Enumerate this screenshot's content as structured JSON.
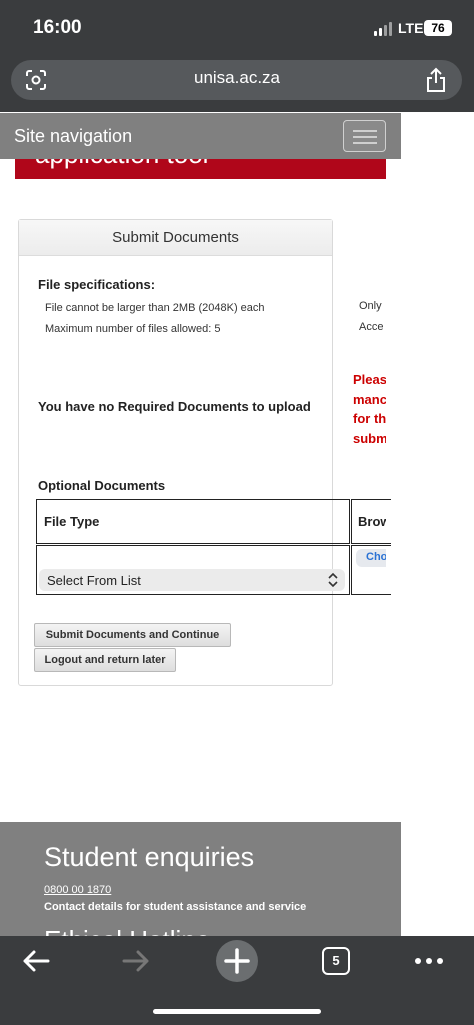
{
  "status_bar": {
    "time": "16:00",
    "network": "LTE",
    "battery": "76"
  },
  "browser": {
    "url": "unisa.ac.za",
    "tab_count": "5"
  },
  "site_nav": {
    "label": "Site navigation"
  },
  "banner": {
    "text": "application tool"
  },
  "panel": {
    "title": "Submit Documents",
    "specs_title": "File specifications:",
    "spec_size": "File cannot be larger than 2MB (2048K) each",
    "spec_count": "Maximum number of files allowed: 5",
    "spec_right_1": "Only",
    "spec_right_2": "Acce",
    "required_msg": "You have no Required Documents to upload",
    "warning_lines": [
      "Pleas",
      "manc",
      "for th",
      "submi"
    ],
    "optional_title": "Optional Documents",
    "col_file_type": "File Type",
    "col_browse": "Brow",
    "select_value": "Select From List",
    "choose_label": "Choose File",
    "submit_button": "Submit Documents and Continue",
    "logout_button": "Logout and return later"
  },
  "footer": {
    "title": "Student enquiries",
    "phone": "0800 00 1870",
    "detail": "Contact details for student assistance and service",
    "next_heading_peek": "Ethical Hotline"
  },
  "icons": {
    "lens": "lens-icon",
    "share": "share-icon",
    "menu": "hamburger-icon",
    "back": "back-arrow-icon",
    "forward": "forward-arrow-icon",
    "new_tab": "plus-icon",
    "more": "more-icon",
    "select": "chevron-updown-icon"
  },
  "colors": {
    "banner": "#b0061a",
    "warning": "#cc0000",
    "chrome": "#3a3c3e",
    "nav": "#808080"
  }
}
